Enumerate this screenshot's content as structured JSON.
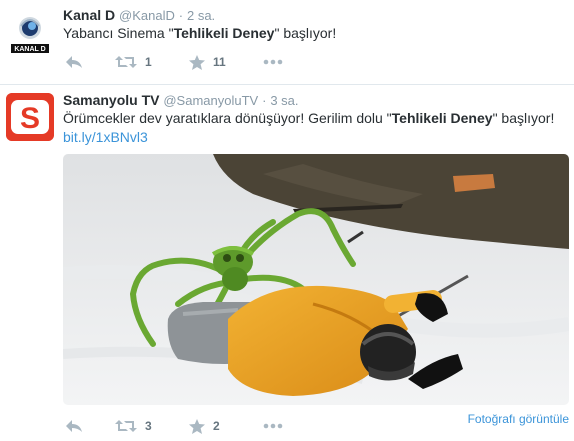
{
  "tweets": [
    {
      "avatar_icon": "kanal-d-logo",
      "avatar_text": "KANAL D",
      "name": "Kanal D",
      "handle": "@KanalD",
      "dot": "·",
      "time": "2 sa.",
      "text_pre": "Yabancı Sinema \"",
      "text_bold": "Tehlikeli Deney",
      "text_post": "\" başlıyor!",
      "retweets": "1",
      "favorites": "11"
    },
    {
      "avatar_icon": "samanyolu-tv-logo",
      "avatar_text": "S",
      "name": "Samanyolu TV",
      "handle": "@SamanyoluTV",
      "dot": "·",
      "time": "3 sa.",
      "text_pre": "Örümcekler dev yaratıklara dönüşüyor! Gerilim dolu \"",
      "text_bold": "Tehlikeli Deney",
      "text_post": "\" başlıyor!",
      "link": "bit.ly/1xBNvl3",
      "view_photo": "Fotoğrafı görüntüle",
      "retweets": "3",
      "favorites": "2"
    }
  ],
  "colors": {
    "text": "#292f33",
    "muted": "#8899a6",
    "link": "#3b94d9",
    "samanyolu_red": "#e53a26"
  }
}
